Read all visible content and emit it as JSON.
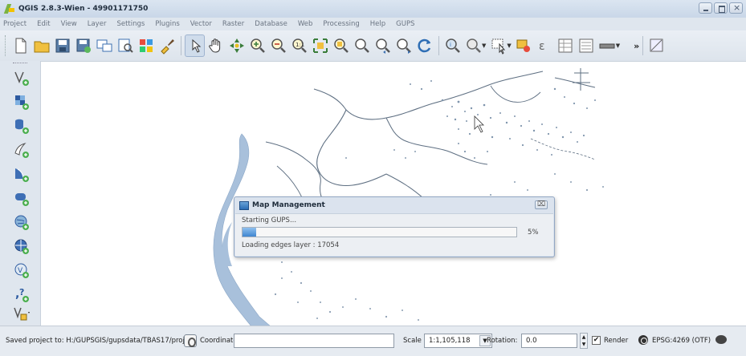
{
  "window": {
    "title": "QGIS 2.8.3-Wien - 49901171750"
  },
  "menu": [
    "Project",
    "Edit",
    "View",
    "Layer",
    "Settings",
    "Plugins",
    "Vector",
    "Raster",
    "Database",
    "Web",
    "Processing",
    "Help",
    "GUPS"
  ],
  "toolbar": {
    "overflow_label": "»"
  },
  "dialog": {
    "title": "Map Management",
    "close_label": "⌧",
    "status": "Starting GUPS...",
    "progress_percent": 5,
    "progress_label": "5%",
    "detail": "Loading edges layer : 17054"
  },
  "statusbar": {
    "message": "Saved project to: H:/GUPSGIS/gupsdata/TBAS17/proj",
    "coordinate_label": "Coordinate:",
    "coordinate_value": "",
    "scale_label": "Scale",
    "scale_value": "1:1,105,118",
    "rotation_label": "Rotation:",
    "rotation_value": "0.0",
    "render_label": "Render",
    "render_checked": "✔",
    "crs_label": "EPSG:4269 (OTF)"
  },
  "colors": {
    "water": "#a8c0db",
    "road": "#5e6f82",
    "progress": "#3f86d0"
  }
}
